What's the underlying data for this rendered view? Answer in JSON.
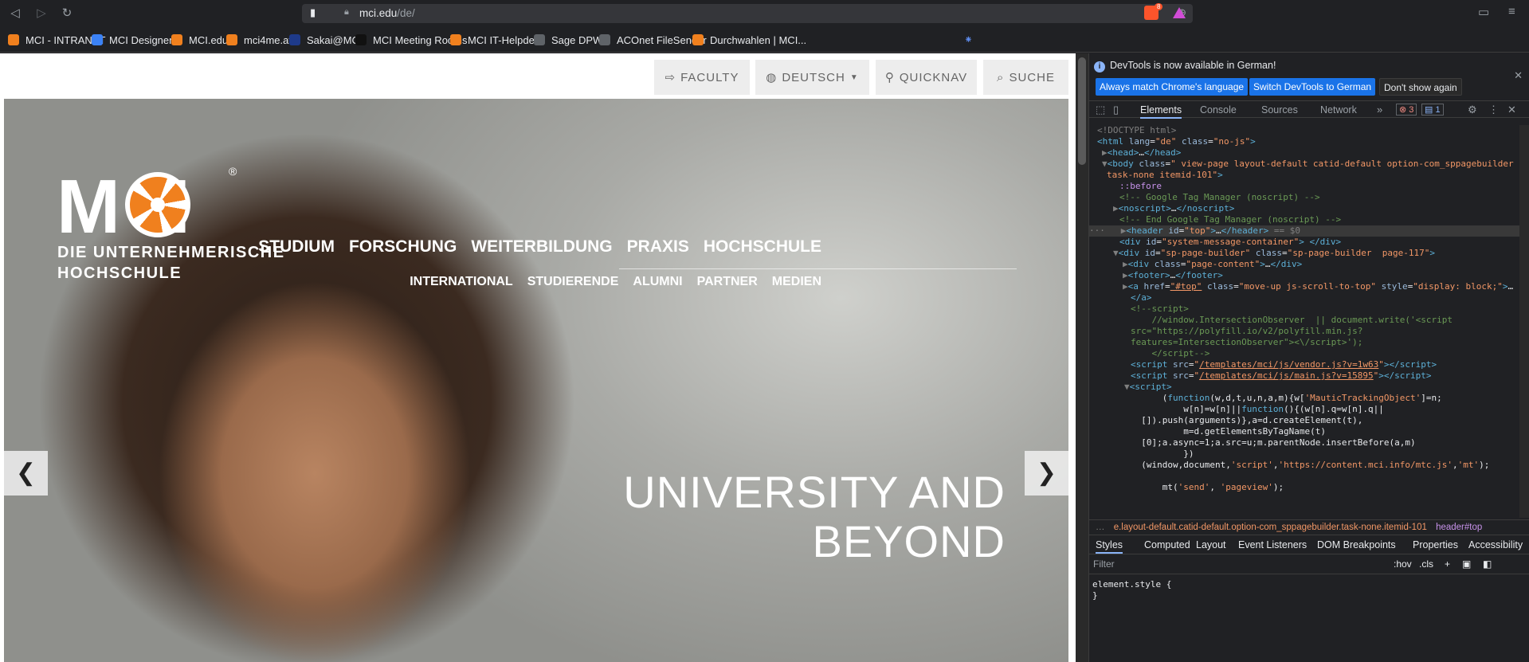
{
  "browser": {
    "url_host": "mci.edu",
    "url_path": "/de/",
    "bookmarks": [
      {
        "label": "MCI - INTRANET",
        "color": "#f0801e"
      },
      {
        "label": "MCI Designer 2",
        "color": "#3b82f6"
      },
      {
        "label": "MCI.edu",
        "color": "#f0801e"
      },
      {
        "label": "mci4me.at",
        "color": "#f0801e"
      },
      {
        "label": "Sakai@MCI",
        "color": "#1e3a8a"
      },
      {
        "label": "MCI Meeting Rooms",
        "color": "#111111"
      },
      {
        "label": "MCI IT-Helpdesk",
        "color": "#f0801e"
      },
      {
        "label": "Sage DPW",
        "color": "#5f6368"
      },
      {
        "label": "ACOnet FileSender",
        "color": "#5f6368"
      },
      {
        "label": "Durchwahlen | MCI...",
        "color": "#f0801e"
      }
    ],
    "extension_badge": "8"
  },
  "site": {
    "utility": {
      "faculty": "FACULTY",
      "language": "DEUTSCH",
      "quicknav": "QUICKNAV",
      "search": "SUCHE"
    },
    "logo_registered": "®",
    "tagline_1": "DIE UNTERNEHMERISCHE",
    "tagline_2": "HOCHSCHULE",
    "main_nav": [
      "STUDIUM",
      "FORSCHUNG",
      "WEITERBILDUNG",
      "PRAXIS",
      "HOCHSCHULE"
    ],
    "sub_nav": [
      "INTERNATIONAL",
      "STUDIERENDE",
      "ALUMNI",
      "PARTNER",
      "MEDIEN"
    ],
    "headline_1": "UNIVERSITY AND",
    "headline_2": "BEYOND",
    "accent": "#f0801e"
  },
  "devtools": {
    "info": "DevTools is now available in German!",
    "btn_match": "Always match Chrome's language",
    "btn_switch": "Switch DevTools to German",
    "btn_dont": "Don't show again",
    "tabs": [
      "Elements",
      "Console",
      "Sources",
      "Network"
    ],
    "error_count": "3",
    "message_count": "1",
    "breadcrumb_1": "e.layout-default.catid-default.option-com_sppagebuilder.task-none.itemid-101",
    "breadcrumb_2": "header#top",
    "style_tabs": [
      "Styles",
      "Computed",
      "Layout",
      "Event Listeners",
      "DOM Breakpoints",
      "Properties",
      "Accessibility"
    ],
    "filter_placeholder": "Filter",
    "hov": ":hov",
    "cls": ".cls",
    "element_style_1": "element.style {",
    "element_style_2": "}"
  }
}
